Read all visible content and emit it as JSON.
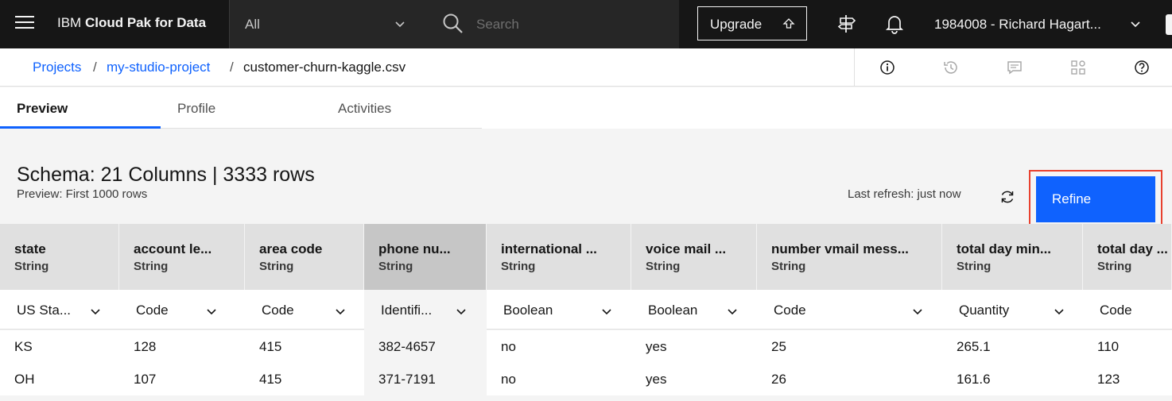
{
  "header": {
    "brand_prefix": "IBM",
    "brand_name": "Cloud Pak for Data",
    "scope_selected": "All",
    "search_placeholder": "Search",
    "upgrade_label": "Upgrade",
    "account": "1984008 - Richard Hagart..."
  },
  "breadcrumb": {
    "items": [
      "Projects",
      "my-studio-project",
      "customer-churn-kaggle.csv"
    ],
    "separator": "/"
  },
  "tabs": [
    {
      "label": "Preview",
      "active": true
    },
    {
      "label": "Profile",
      "active": false
    },
    {
      "label": "Activities",
      "active": false
    }
  ],
  "schema": {
    "title": "Schema:  21 Columns  |  3333 rows",
    "subtitle": "Preview: First 1000 rows",
    "last_refresh": "Last refresh: just now",
    "refine_label": "Refine"
  },
  "table": {
    "columns": [
      {
        "name": "state",
        "type": "String",
        "class": "US Sta..."
      },
      {
        "name": "account le...",
        "type": "String",
        "class": "Code"
      },
      {
        "name": "area code",
        "type": "String",
        "class": "Code"
      },
      {
        "name": "phone nu...",
        "type": "String",
        "class": "Identifi...",
        "selected": true
      },
      {
        "name": "international ...",
        "type": "String",
        "class": "Boolean"
      },
      {
        "name": "voice mail ...",
        "type": "String",
        "class": "Boolean"
      },
      {
        "name": "number vmail mess...",
        "type": "String",
        "class": "Code"
      },
      {
        "name": "total day min...",
        "type": "String",
        "class": "Quantity"
      },
      {
        "name": "total day ...",
        "type": "String",
        "class": "Code"
      }
    ],
    "rows": [
      [
        "KS",
        "128",
        "415",
        "382-4657",
        "no",
        "yes",
        "25",
        "265.1",
        "110"
      ],
      [
        "OH",
        "107",
        "415",
        "371-7191",
        "no",
        "yes",
        "26",
        "161.6",
        "123"
      ]
    ]
  },
  "colors": {
    "header_bg": "#161616",
    "accent": "#0f62fe",
    "highlight_outline": "#e8412f"
  }
}
